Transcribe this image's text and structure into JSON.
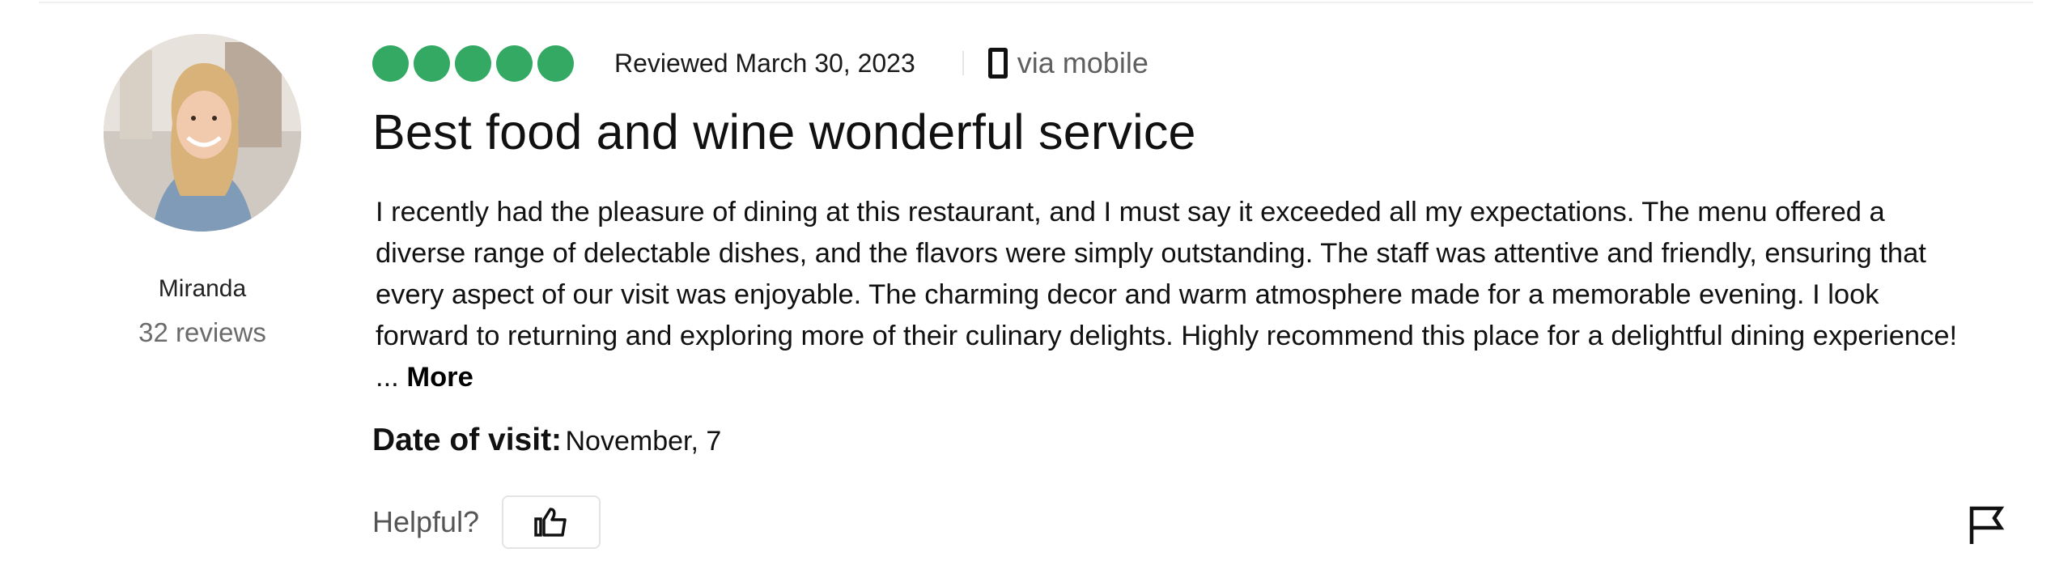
{
  "reviewer": {
    "name": "Miranda",
    "review_count": "32 reviews"
  },
  "review": {
    "rating": 5,
    "rating_max": 5,
    "bubble_color": "#34a963",
    "reviewed_date": "Reviewed March 30, 2023",
    "via": "via mobile",
    "title": "Best food and wine wonderful service",
    "body": "I recently had the pleasure of dining at this restaurant, and I must say it exceeded all my expectations. The menu offered a diverse range of delectable dishes, and the flavors were simply outstanding. The staff was attentive and friendly, ensuring that every aspect of our visit was enjoyable. The charming decor and warm atmosphere made for a memorable evening. I look forward to returning and exploring more of their culinary delights. Highly recommend this place for a delightful dining experience! ...",
    "more_label": "More",
    "visit_label": "Date of visit:",
    "visit_value": "November, 7"
  },
  "actions": {
    "helpful_label": "Helpful?",
    "thumb_icon": "thumbs-up-icon",
    "flag_icon": "flag-icon"
  }
}
